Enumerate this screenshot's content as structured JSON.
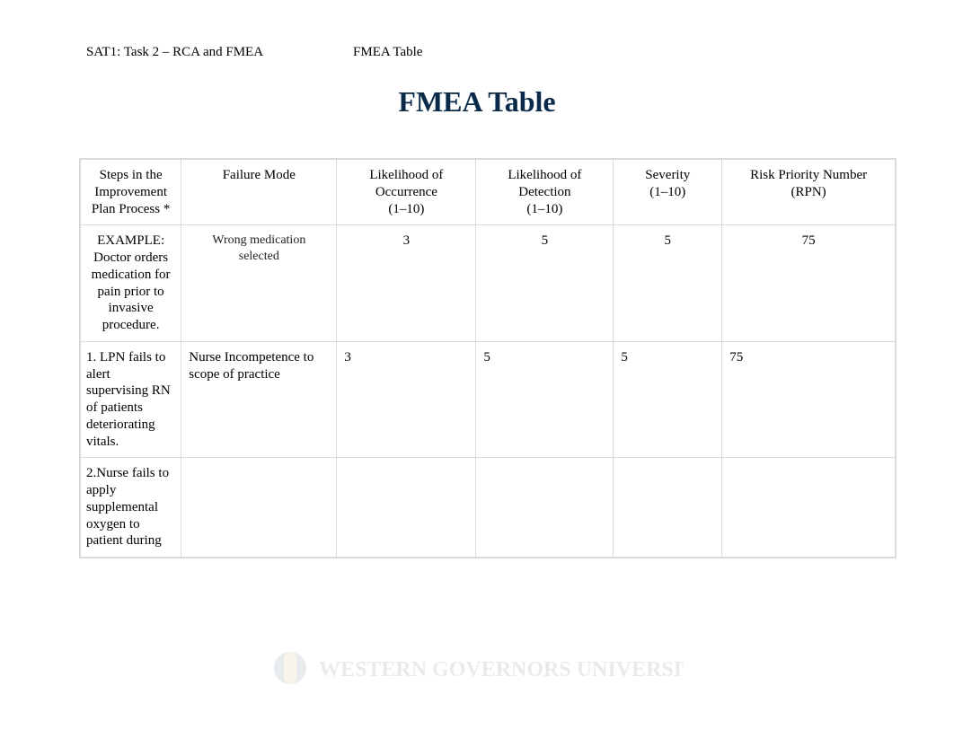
{
  "header": {
    "left": "SAT1: Task 2 – RCA and FMEA",
    "right": "FMEA Table"
  },
  "title": "FMEA Table",
  "columns": {
    "step": "Steps in the Improvement Plan Process *",
    "mode": "Failure Mode",
    "occurrence_l1": "Likelihood of Occurrence",
    "occurrence_l2": "(1–10)",
    "detection_l1": "Likelihood of Detection",
    "detection_l2": "(1–10)",
    "severity_l1": "Severity",
    "severity_l2": "(1–10)",
    "rpn_l1": "Risk Priority Number",
    "rpn_l2": "(RPN)"
  },
  "rows": [
    {
      "example": true,
      "step": "EXAMPLE: Doctor orders medication for pain prior to invasive procedure.",
      "mode": "Wrong medication selected",
      "occurrence": "3",
      "detection": "5",
      "severity": "5",
      "rpn": "75"
    },
    {
      "example": false,
      "step": "1. LPN fails to alert supervising RN of patients deteriorating vitals.",
      "mode": "Nurse Incompetence to scope of practice",
      "occurrence": "3",
      "detection": "5",
      "severity": "5",
      "rpn": "75"
    },
    {
      "example": false,
      "step": "2.Nurse fails to apply supplemental oxygen to patient during",
      "mode": "",
      "occurrence": "",
      "detection": "",
      "severity": "",
      "rpn": ""
    }
  ],
  "footer": {
    "page": ""
  },
  "watermark": {
    "text": "WESTERN GOVERNORS UNIVERSITY"
  }
}
